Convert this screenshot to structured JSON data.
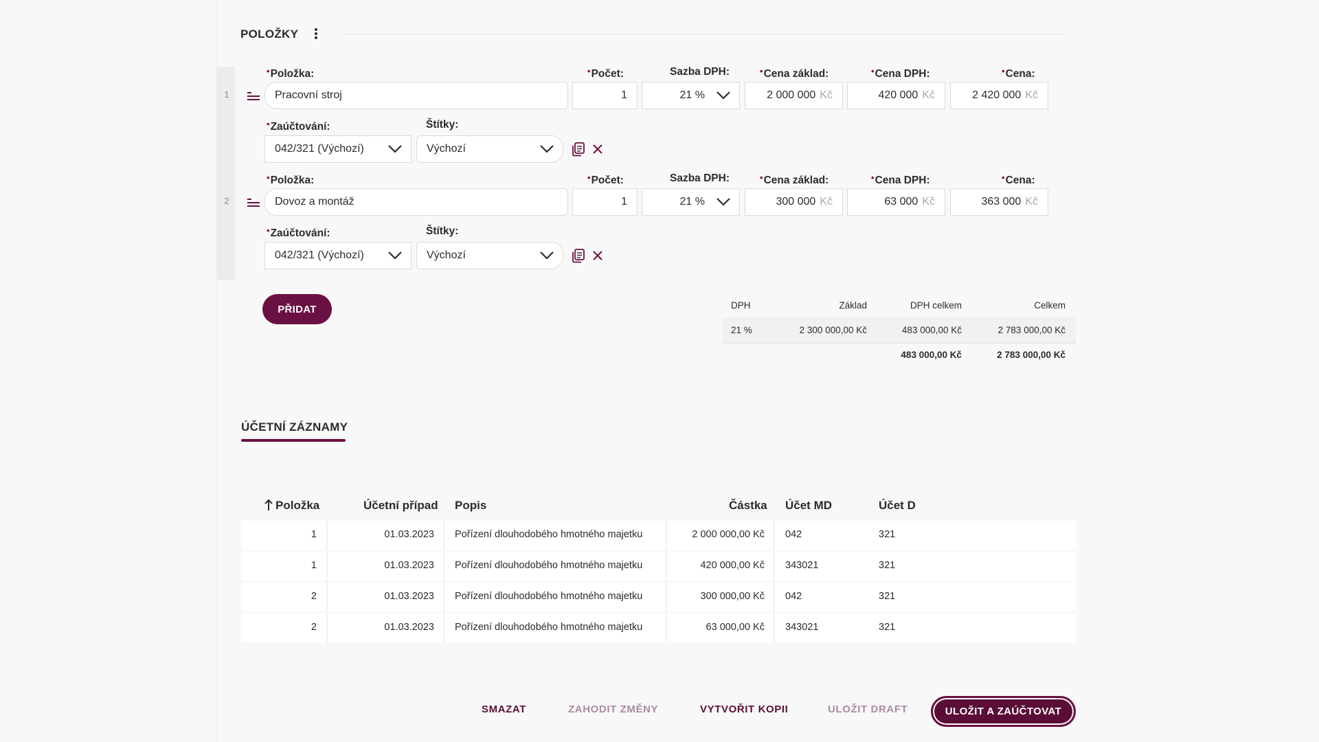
{
  "items_section": {
    "title": "POLOŽKY",
    "rows": [
      {
        "number": "1",
        "labels": {
          "item": "Položka:",
          "count": "Počet:",
          "vat_rate": "Sazba DPH:",
          "base_price": "Cena základ:",
          "vat_price": "Cena DPH:",
          "price": "Cena:",
          "accounting": "Zaúčtování:",
          "tags": "Štítky:"
        },
        "item": "Pracovní stroj",
        "count": "1",
        "vat_rate": "21 %",
        "base_price": "2 000 000",
        "vat_price": "420 000",
        "price": "2 420 000",
        "currency": "Kč",
        "accounting": "042/321 (Výchozí)",
        "tags": "Výchozí"
      },
      {
        "number": "2",
        "labels": {
          "item": "Položka:",
          "count": "Počet:",
          "vat_rate": "Sazba DPH:",
          "base_price": "Cena základ:",
          "vat_price": "Cena DPH:",
          "price": "Cena:",
          "accounting": "Zaúčtování:",
          "tags": "Štítky:"
        },
        "item": "Dovoz a montáž",
        "count": "1",
        "vat_rate": "21 %",
        "base_price": "300 000",
        "vat_price": "63 000",
        "price": "363 000",
        "currency": "Kč",
        "accounting": "042/321 (Výchozí)",
        "tags": "Výchozí"
      }
    ],
    "add_button": "PŘIDAT"
  },
  "vat_summary": {
    "headers": [
      "DPH",
      "Základ",
      "DPH celkem",
      "Celkem"
    ],
    "rows": [
      [
        "21 %",
        "2 300 000,00 Kč",
        "483 000,00 Kč",
        "2 783 000,00 Kč"
      ]
    ],
    "totals": {
      "vat_total": "483 000,00 Kč",
      "total": "2 783 000,00 Kč"
    }
  },
  "records_section": {
    "tab": "ÚČETNÍ ZÁZNAMY",
    "sort_icon": "arrow-up-icon",
    "headers": [
      "Položka",
      "Účetní případ",
      "Popis",
      "Částka",
      "Účet MD",
      "Účet D"
    ],
    "rows": [
      [
        "1",
        "01.03.2023",
        "Pořízení dlouhodobého hmotného majetku",
        "2 000 000,00 Kč",
        "042",
        "321"
      ],
      [
        "1",
        "01.03.2023",
        "Pořízení dlouhodobého hmotného majetku",
        "420 000,00 Kč",
        "343021",
        "321"
      ],
      [
        "2",
        "01.03.2023",
        "Pořízení dlouhodobého hmotného majetku",
        "300 000,00 Kč",
        "042",
        "321"
      ],
      [
        "2",
        "01.03.2023",
        "Pořízení dlouhodobého hmotného majetku",
        "63 000,00 Kč",
        "343021",
        "321"
      ]
    ]
  },
  "footer": {
    "delete": "SMAZAT",
    "discard": "ZAHODIT ZMĚNY",
    "copy": "VYTVOŘIT KOPII",
    "draft": "ULOŽIT DRAFT",
    "save": "ULOŽIT A ZAÚČTOVAT"
  },
  "colors": {
    "accent": "#6b1042",
    "required": "#8a1346",
    "muted": "#a98aa0"
  }
}
